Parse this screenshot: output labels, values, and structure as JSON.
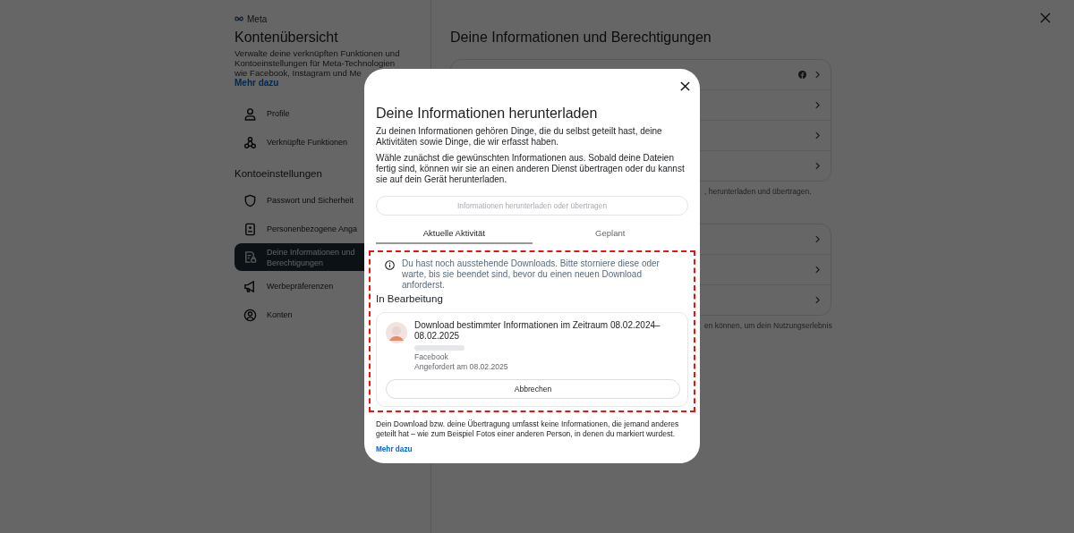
{
  "brand": "Meta",
  "sidebar": {
    "title": "Kontenübersicht",
    "description": "Verwalte deine verknüpften Funktionen und Kontoeinstellungen für Meta-Technologien wie Facebook, Instagram und Me",
    "link": "Mehr dazu",
    "groups": [
      {
        "items": [
          {
            "label": "Profile",
            "selected": false
          },
          {
            "label": "Verknüpfte Funktionen",
            "selected": false
          }
        ]
      },
      {
        "heading": "Kontoeinstellungen",
        "items": [
          {
            "label": "Passwort und Sicherheit",
            "selected": false
          },
          {
            "label": "Personenbezogene Anga",
            "selected": false
          },
          {
            "label": "Deine Informationen und Berechtigungen",
            "selected": true
          },
          {
            "label": "Werbepräferenzen",
            "selected": false
          },
          {
            "label": "Konten",
            "selected": false
          }
        ]
      }
    ]
  },
  "main": {
    "title": "Deine Informationen und Berechtigungen",
    "cards": [
      {
        "rows": [
          {
            "kind": "facebook"
          },
          {
            "kind": "plain"
          },
          {
            "kind": "plain"
          },
          {
            "kind": "plain"
          }
        ],
        "caption": ", herunterladen und übertragen."
      },
      {
        "rows": [
          {
            "kind": "plain"
          },
          {
            "kind": "plain"
          },
          {
            "kind": "plain"
          }
        ],
        "caption": "en können, um dein Nutzungserlebnis"
      }
    ]
  },
  "dialog": {
    "title": "Deine Informationen herunterladen",
    "paragraphs": [
      "Zu deinen Informationen gehören Dinge, die du selbst geteilt hast, deine Aktivitäten sowie Dinge, die wir erfasst haben.",
      "Wähle zunächst die gewünschten Informationen aus. Sobald deine Dateien fertig sind, können wir sie an einen anderen Dienst übertragen oder du kannst sie auf dein Gerät herunterladen."
    ],
    "action_button": {
      "label": "Informationen herunterladen oder übertragen",
      "disabled": true
    },
    "tabs": [
      {
        "label": "Aktuelle Aktivität",
        "selected": true
      },
      {
        "label": "Geplant",
        "selected": false
      }
    ],
    "notice": "Du hast noch ausstehende Downloads. Bitte storniere diese oder warte, bis sie beendet sind, bevor du einen neuen Download anforderst.",
    "section_heading": "In Bearbeitung",
    "request": {
      "title": "Download bestimmter Informationen im Zeitraum 08.02.2024–08.02.2025",
      "source": "Facebook",
      "requested": "Angefordert am 08.02.2025",
      "cancel_button": "Abbrechen"
    },
    "footer": "Dein Download bzw. deine Übertragung umfasst keine Informationen, die jemand anderes geteilt hat – wie zum Beispiel Fotos einer anderen Person, in denen du markiert wurdest.",
    "footer_link": "Mehr dazu"
  }
}
